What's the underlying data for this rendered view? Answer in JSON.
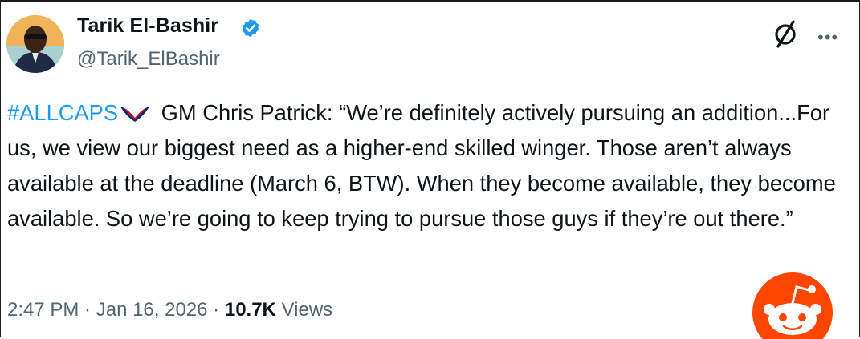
{
  "author": {
    "name": "Tarik El-Bashir",
    "handle": "@Tarik_ElBashir",
    "verified": true
  },
  "tweet": {
    "hashtag": "#ALLCAPS",
    "text": " GM Chris Patrick: “We’re definitely actively pursuing an addition...For us, we view our biggest need as a higher-end skilled winger. Those aren’t always available at the deadline (March 6, BTW). When they become available, they become available. So we’re going to keep trying to pursue those guys if they’re out there.”"
  },
  "meta": {
    "time": "2:47 PM",
    "separator": " · ",
    "date": "Jan 16, 2026",
    "views_count": "10.7K",
    "views_label": " Views"
  },
  "icons": {
    "verified": "verified-badge-icon",
    "grok": "grok-icon",
    "more": "more-icon",
    "team_logo": "capitals-eagle-icon",
    "watermark": "reddit-snoo-icon"
  },
  "colors": {
    "link": "#1d9bf0",
    "secondary_text": "#536471",
    "verified": "#1d9bf0",
    "reddit": "#ff4500"
  }
}
